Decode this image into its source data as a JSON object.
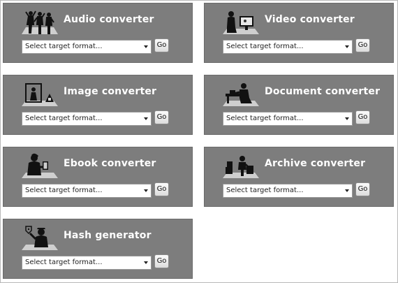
{
  "cards": [
    {
      "title": "Audio converter",
      "icon": "dancers-icon",
      "select_placeholder": "Select target format...",
      "go_label": "Go"
    },
    {
      "title": "Video converter",
      "icon": "person-watching-screen-icon",
      "select_placeholder": "Select target format...",
      "go_label": "Go"
    },
    {
      "title": "Image converter",
      "icon": "framed-picture-icon",
      "select_placeholder": "Select target format...",
      "go_label": "Go"
    },
    {
      "title": "Document converter",
      "icon": "person-at-desk-icon",
      "select_placeholder": "Select target format...",
      "go_label": "Go"
    },
    {
      "title": "Ebook converter",
      "icon": "person-reading-tablet-icon",
      "select_placeholder": "Select target format...",
      "go_label": "Go"
    },
    {
      "title": "Archive converter",
      "icon": "person-with-boxes-icon",
      "select_placeholder": "Select target format...",
      "go_label": "Go"
    },
    {
      "title": "Hash generator",
      "icon": "person-with-tag-icon",
      "select_placeholder": "Select target format...",
      "go_label": "Go"
    }
  ],
  "colors": {
    "card_bg": "#7d7d7d",
    "title": "#ffffff"
  }
}
